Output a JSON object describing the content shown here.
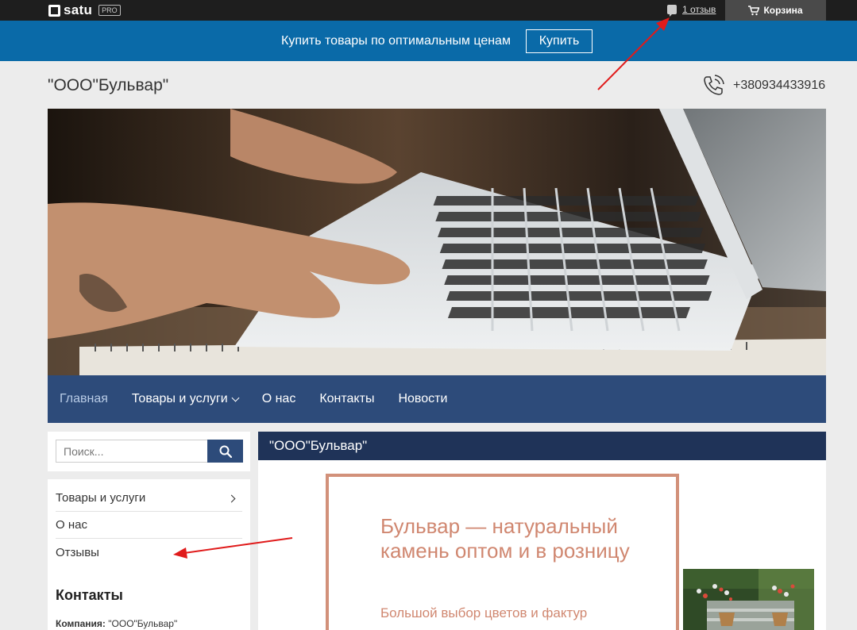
{
  "topbar": {
    "logo_text": "satu",
    "logo_badge": "PRO",
    "reviews_label": "1 отзыв",
    "cart_label": "Корзина"
  },
  "promo": {
    "text": "Купить товары по оптимальным ценам",
    "button": "Купить"
  },
  "header": {
    "company": "\"ООО\"Бульвар\"",
    "phone": "+380934433916"
  },
  "slider": {
    "slides": 3,
    "active_slide": 2
  },
  "nav": {
    "items": [
      {
        "label": "Главная",
        "active": true
      },
      {
        "label": "Товары и услуги",
        "has_dropdown": true
      },
      {
        "label": "О нас"
      },
      {
        "label": "Контакты"
      },
      {
        "label": "Новости"
      }
    ]
  },
  "sidebar": {
    "search_placeholder": "Поиск...",
    "menu": [
      {
        "label": "Товары и услуги",
        "has_submenu": true
      },
      {
        "label": "О нас"
      },
      {
        "label": "Отзывы"
      }
    ],
    "contacts_title": "Контакты",
    "company_label": "Компания:",
    "company_value": "\"ООО\"Бульвар\""
  },
  "main": {
    "title": "\"ООО\"Бульвар\"",
    "card_title": "Бульвар — натуральный камень оптом и в розницу",
    "card_subtitle": "Большой выбор цветов и фактур"
  },
  "colors": {
    "topbar": "#1e1e1e",
    "promo": "#0a6aa8",
    "nav": "#2d4b7a",
    "main_header": "#1f3358",
    "accent": "#d08770",
    "annotation": "#e01b1b"
  }
}
